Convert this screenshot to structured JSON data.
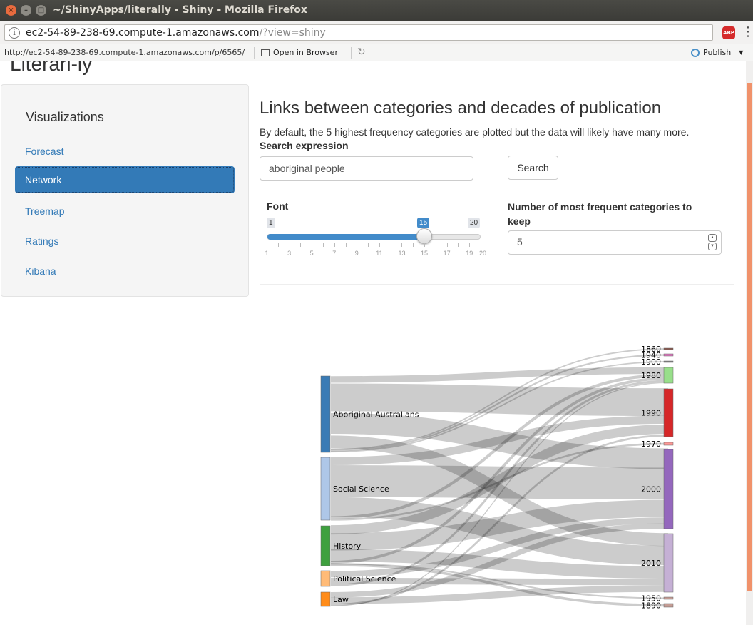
{
  "window": {
    "title": "~/ShinyApps/literally - Shiny - Mozilla Firefox"
  },
  "browser": {
    "url_host": "ec2-54-89-238-69.compute-1.amazonaws.com",
    "url_rest": "/?view=shiny",
    "abp_label": "ABP"
  },
  "viewer_toolbar": {
    "url": "http://ec2-54-89-238-69.compute-1.amazonaws.com/p/6565/",
    "open_label": "Open in Browser",
    "publish_label": "Publish"
  },
  "app": {
    "title": "Literari-ly"
  },
  "sidebar": {
    "heading": "Visualizations",
    "items": [
      {
        "label": "Forecast",
        "active": false
      },
      {
        "label": "Network",
        "active": true
      },
      {
        "label": "Treemap",
        "active": false
      },
      {
        "label": "Ratings",
        "active": false
      },
      {
        "label": "Kibana",
        "active": false
      }
    ]
  },
  "main": {
    "title": "Links between categories and decades of publication",
    "description": "By default, the 5 highest frequency categories are plotted but the data will likely have many more.",
    "search_label": "Search expression",
    "search_value": "aboriginal people",
    "search_button": "Search",
    "font_label": "Font",
    "font_slider": {
      "min": "1",
      "max": "20",
      "value": "15",
      "value_num": 15,
      "min_num": 1,
      "max_num": 20,
      "tick_labels": [
        "1",
        "3",
        "5",
        "7",
        "9",
        "11",
        "13",
        "15",
        "17",
        "19",
        "20"
      ]
    },
    "keep_label": "Number of most frequent categories to keep",
    "keep_value": "5"
  },
  "chart_data": {
    "type": "sankey",
    "sources": [
      {
        "name": "Aboriginal Australians",
        "color": "#3a7bb5"
      },
      {
        "name": "Social Science",
        "color": "#aec7e8"
      },
      {
        "name": "History",
        "color": "#3ea03e"
      },
      {
        "name": "Political Science",
        "color": "#ffbb78"
      },
      {
        "name": "Law",
        "color": "#ff8c1a"
      }
    ],
    "targets": [
      {
        "name": "1860",
        "color": "#8c564b"
      },
      {
        "name": "1940",
        "color": "#e377c2"
      },
      {
        "name": "1900",
        "color": "#7f7f7f"
      },
      {
        "name": "1980",
        "color": "#98df8a"
      },
      {
        "name": "1990",
        "color": "#d62728"
      },
      {
        "name": "1970",
        "color": "#ff9896"
      },
      {
        "name": "2000",
        "color": "#9467bd"
      },
      {
        "name": "2010",
        "color": "#c5b0d5"
      },
      {
        "name": "1950",
        "color": "#c49c94"
      },
      {
        "name": "1890",
        "color": "#c49c94"
      }
    ]
  }
}
